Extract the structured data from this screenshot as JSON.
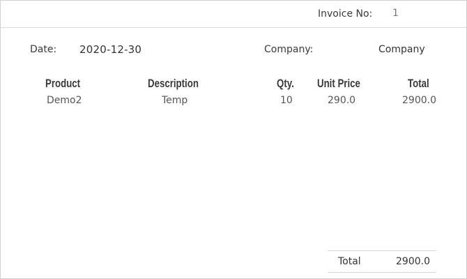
{
  "invoice": {
    "label": "Invoice No:",
    "number": "1"
  },
  "meta": {
    "date_label": "Date:",
    "date_value": "2020-12-30",
    "company_label": "Company:",
    "company_value": "Company"
  },
  "table": {
    "columns": [
      "Product",
      "Description",
      "Qty.",
      "Unit Price",
      "Total"
    ],
    "rows": [
      {
        "product": "Demo2",
        "description": "Temp",
        "qty": "10",
        "unit_price": "290.0",
        "total": "2900.0"
      }
    ]
  },
  "summary": {
    "total_label": "Total",
    "total_value": "2900.0"
  }
}
